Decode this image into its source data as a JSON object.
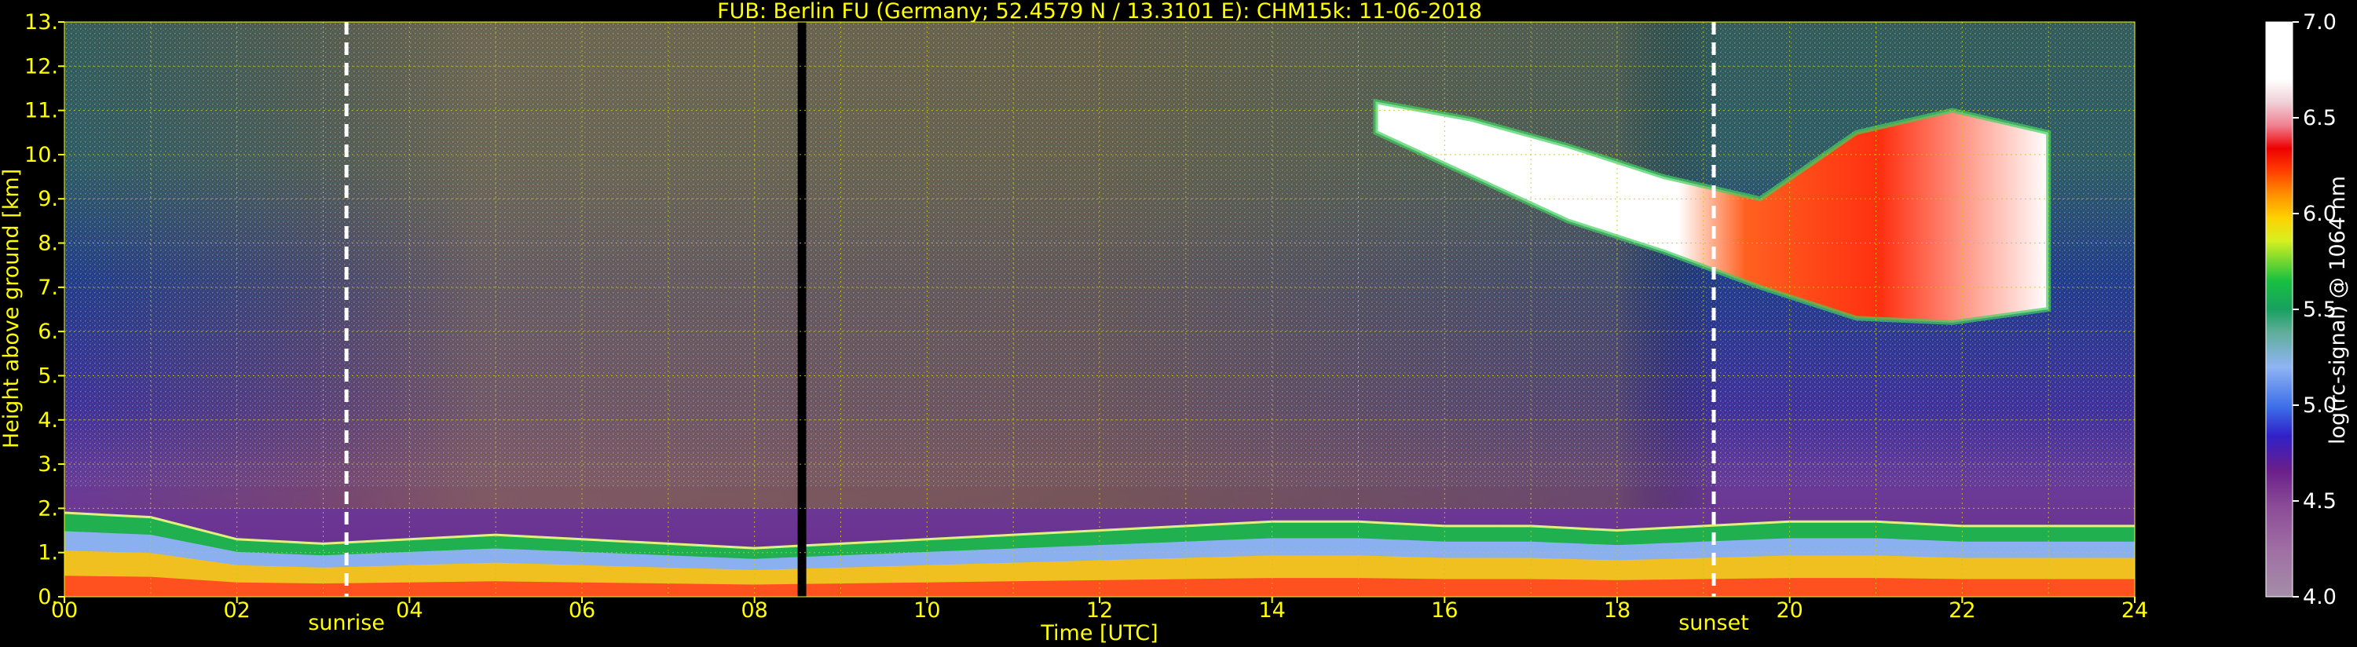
{
  "chart_data": {
    "type": "heatmap",
    "title": "FUB: Berlin FU (Germany; 52.4579 N / 13.3101 E):    CHM15k: 11-06-2018",
    "xlabel": "Time [UTC]",
    "ylabel": "Height above ground [km]",
    "colorbar_label": "log(rc-signal) @ 1064 nm",
    "xlim": [
      0,
      24
    ],
    "ylim": [
      0,
      13
    ],
    "clim": [
      4.0,
      7.0
    ],
    "x_ticks": [
      "00",
      "02",
      "04",
      "06",
      "08",
      "10",
      "12",
      "14",
      "16",
      "18",
      "20",
      "22",
      "24"
    ],
    "y_ticks": [
      "0.",
      "1.",
      "2.",
      "3.",
      "4.",
      "5.",
      "6.",
      "7.",
      "8.",
      "9.",
      "10.",
      "11.",
      "12.",
      "13."
    ],
    "colorbar_ticks": [
      "4.0",
      "4.5",
      "5.0",
      "5.5",
      "6.0",
      "6.5",
      "7.0"
    ],
    "grid": true,
    "annotations": [
      {
        "text": "sunrise",
        "x": 3.27
      },
      {
        "text": "sunset",
        "x": 19.12
      }
    ],
    "missing_data_hours": [
      8.5,
      8.6
    ],
    "layers": [
      {
        "type": "boundary-layer",
        "start": 0,
        "end": 24,
        "top_km": [
          1.9,
          1.8,
          1.3,
          1.2,
          1.3,
          1.4,
          1.3,
          1.2,
          1.1,
          1.2,
          1.3,
          1.4,
          1.5,
          1.6,
          1.7,
          1.7,
          1.6,
          1.6,
          1.5,
          1.6,
          1.7,
          1.7,
          1.6,
          1.6,
          1.6
        ]
      },
      {
        "type": "cirrus",
        "start": 15.2,
        "end": 23.0,
        "base_km": [
          10.5,
          9.5,
          8.5,
          7.8,
          7.0,
          6.3,
          6.2,
          6.5
        ],
        "top_km": [
          11.2,
          10.8,
          10.2,
          9.5,
          9.0,
          10.5,
          11.0,
          10.5
        ]
      }
    ],
    "colors": {
      "axis_text": "#ffff00",
      "grid": "#cccc00",
      "marker_line": "#ffffff",
      "colormap": [
        "#a48ea8",
        "#a070a4",
        "#7f1e8f",
        "#4020c0",
        "#3c6ee8",
        "#7aa2f0",
        "#a8c8f8",
        "#28a068",
        "#10b838",
        "#60e040",
        "#f0f000",
        "#ffb000",
        "#ff6000",
        "#ff0000",
        "#f0a0a8",
        "#ffffff"
      ]
    }
  }
}
